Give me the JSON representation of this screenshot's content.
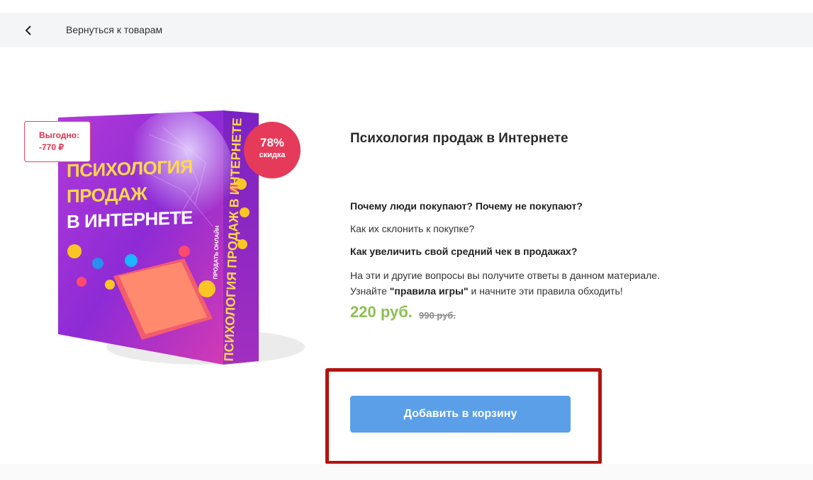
{
  "nav": {
    "back_label": "Вернуться к товарам"
  },
  "product": {
    "discount_label_line1": "Выгодно:",
    "discount_label_line2": "-770 ₽",
    "discount_percent": "78%",
    "discount_word": "скидка",
    "cover_title_1": "ПСИХОЛОГИЯ",
    "cover_title_2": "ПРОДАЖ",
    "cover_title_3": "В ИНТЕРНЕТЕ",
    "cover_side_text": "ПСИХОЛОГИЯ ПРОДАЖ В ИНТЕРНЕТЕ",
    "cover_side_sub": "ПРОДАТЬ ОНЛАЙН",
    "title": "Психология продаж в Интернете",
    "question_1": "Почему люди покупают? Почему не покупают?",
    "question_2": "Как их склонить к покупке?",
    "question_3": "Как увеличить свой средний чек в продажах?",
    "desc_line_1": "На эти и другие вопросы вы получите ответы в данном материале.",
    "desc_line_2_pre": "Узнайте ",
    "desc_line_2_bold": "\"правила игры\"",
    "desc_line_2_post": " и начните эти правила обходить!",
    "price": "220 руб.",
    "old_price": "990 руб."
  },
  "cart": {
    "add_label": "Добавить в корзину"
  },
  "colors": {
    "accent": "#5a9fe8",
    "price": "#8cc152",
    "badge": "#e53a5a",
    "highlight": "#b3140f"
  }
}
